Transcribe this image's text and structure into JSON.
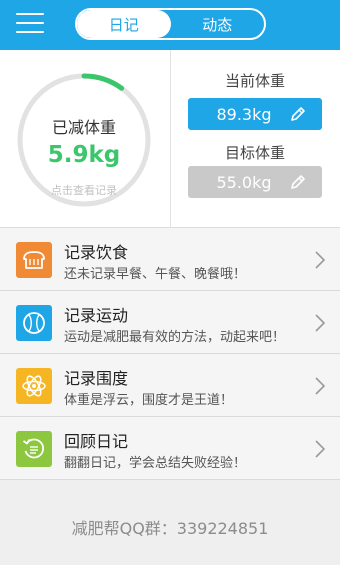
{
  "header": {
    "tabs": [
      {
        "label": "日记",
        "active": true
      },
      {
        "label": "动态",
        "active": false
      }
    ]
  },
  "summary": {
    "lost_label": "已减体重",
    "lost_value": "5.9kg",
    "hint": "点击查看记录",
    "progress_fraction": 0.1,
    "current_label": "当前体重",
    "current_value": "89.3kg",
    "target_label": "目标体重",
    "target_value": "55.0kg"
  },
  "list": [
    {
      "title": "记录饮食",
      "subtitle": "还未记录早餐、午餐、晚餐哦！",
      "icon": "bread-icon",
      "color": "#f08a35"
    },
    {
      "title": "记录运动",
      "subtitle": "运动是减肥最有效的方法，动起来吧！",
      "icon": "baseball-icon",
      "color": "#1ea6e6"
    },
    {
      "title": "记录围度",
      "subtitle": "体重是浮云，围度才是王道！",
      "icon": "atom-icon",
      "color": "#f6b623"
    },
    {
      "title": "回顾日记",
      "subtitle": "翻翻日记，学会总结失败经验！",
      "icon": "history-icon",
      "color": "#8dc63f"
    }
  ],
  "footer": {
    "text": "减肥帮QQ群：339224851"
  },
  "colors": {
    "accent": "#1ea6e6",
    "progress": "#3bc66b"
  }
}
